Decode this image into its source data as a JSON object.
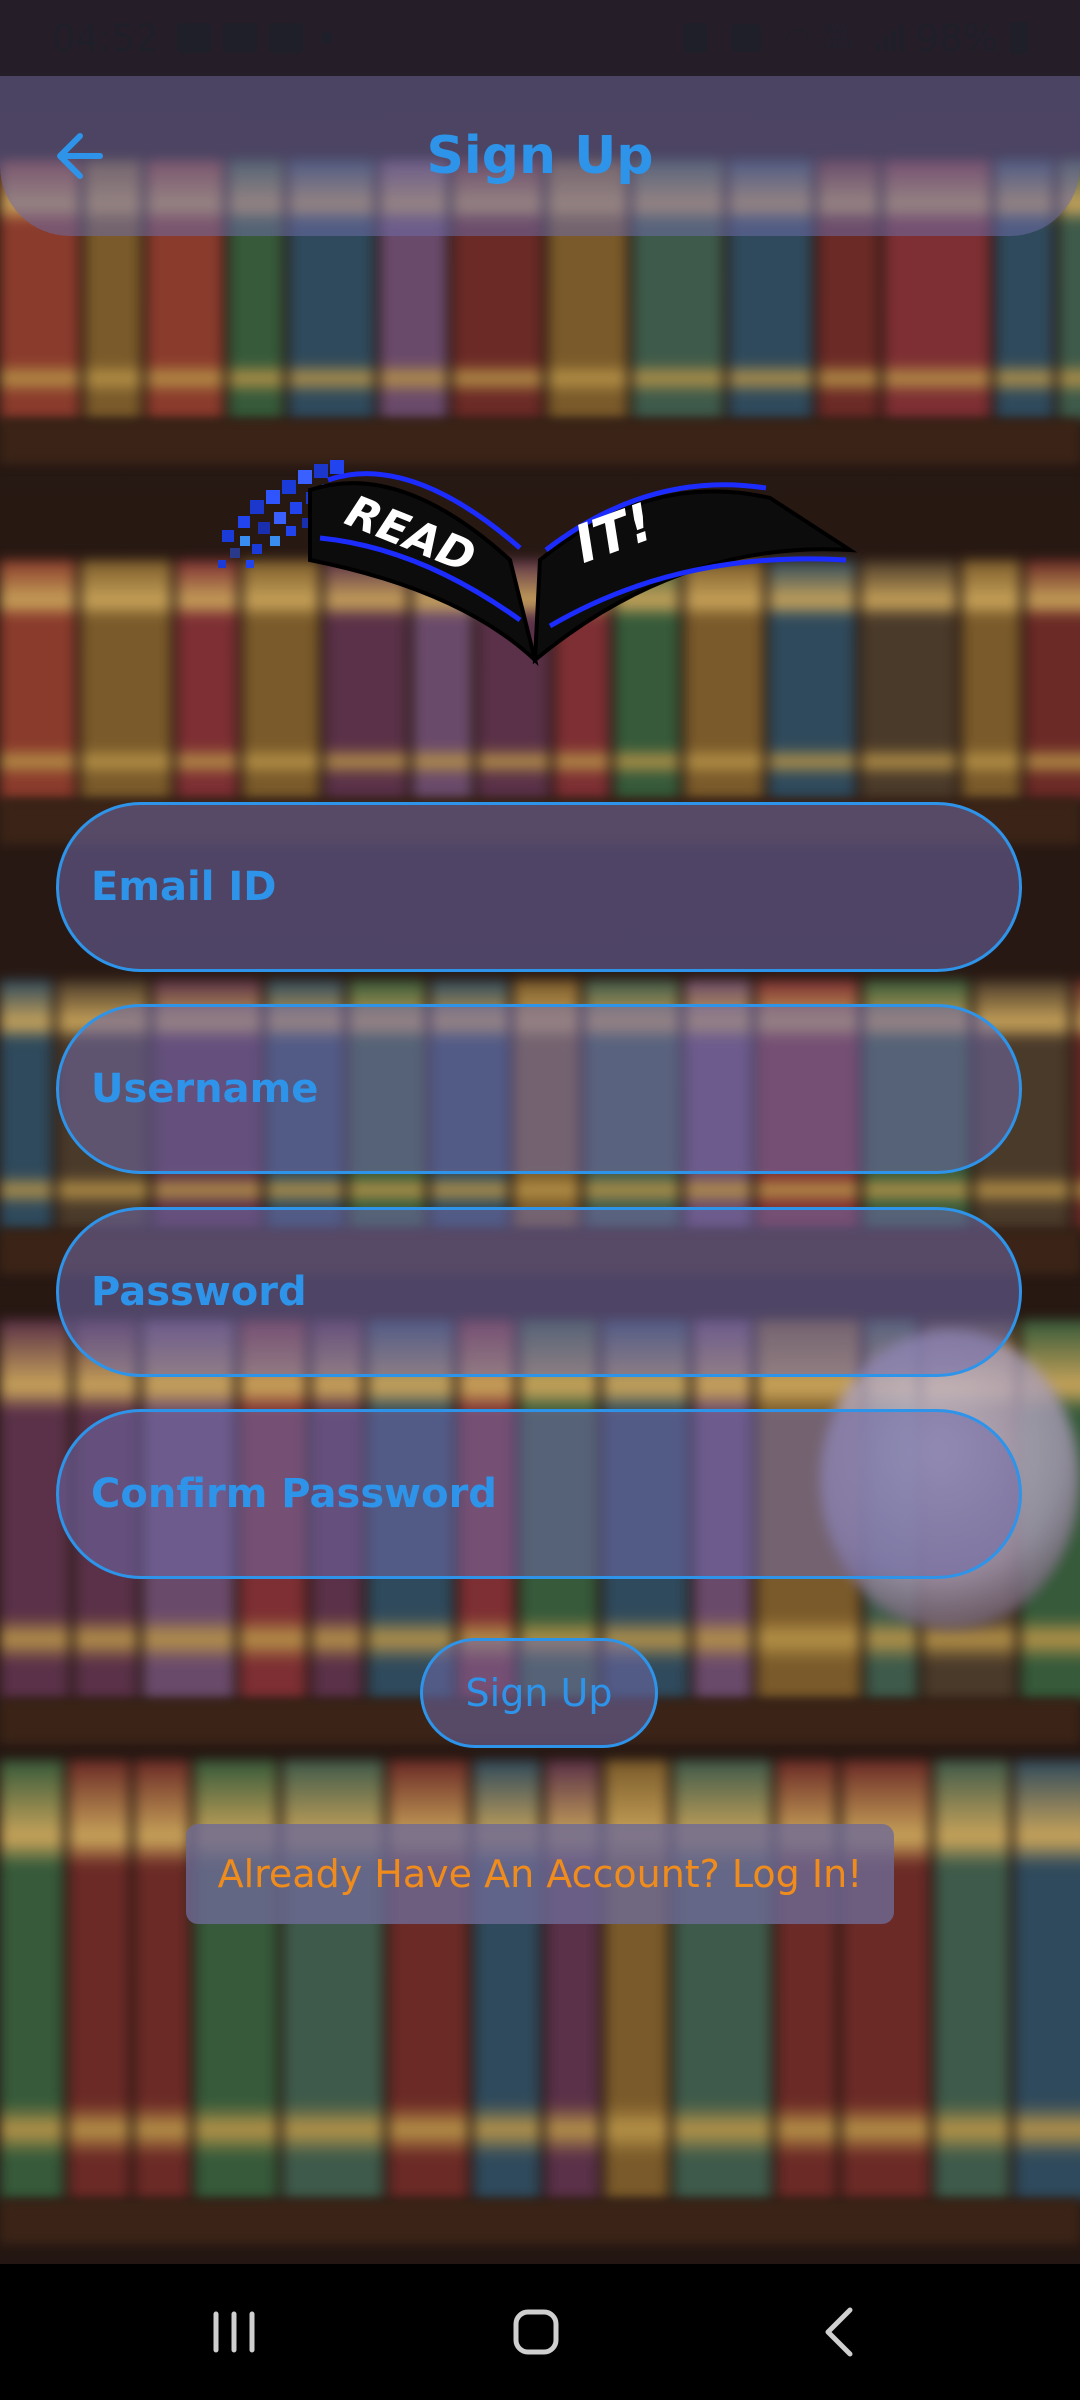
{
  "status_bar": {
    "time": "04:52",
    "left_icons": [
      "gallery-icon",
      "shopping-bag-icon",
      "youtube-icon",
      "dot-icon"
    ],
    "right_icons": [
      "alarm-icon",
      "mute-icon",
      "wifi-icon",
      "volte-icon",
      "signal-icon"
    ],
    "volte_label": "Vo)) LTE1",
    "battery_percent": "98%"
  },
  "app_bar": {
    "back_icon": "arrow-left-icon",
    "title": "Sign Up"
  },
  "logo": {
    "text_left": "READ",
    "text_right": "IT!"
  },
  "form": {
    "email_placeholder": "Email ID",
    "username_placeholder": "Username",
    "password_placeholder": "Password",
    "confirm_password_placeholder": "Confirm Password",
    "email_value": "",
    "username_value": "",
    "password_value": "",
    "confirm_password_value": ""
  },
  "actions": {
    "signup_label": "Sign Up",
    "login_link_label": "Already Have An Account? Log In!"
  },
  "nav_bar": {
    "icons": [
      "recent-apps-icon",
      "home-icon",
      "back-icon"
    ]
  },
  "colors": {
    "accent_blue": "#2e94ea",
    "link_orange": "#f08c1c",
    "field_fill": "#7069aa"
  }
}
